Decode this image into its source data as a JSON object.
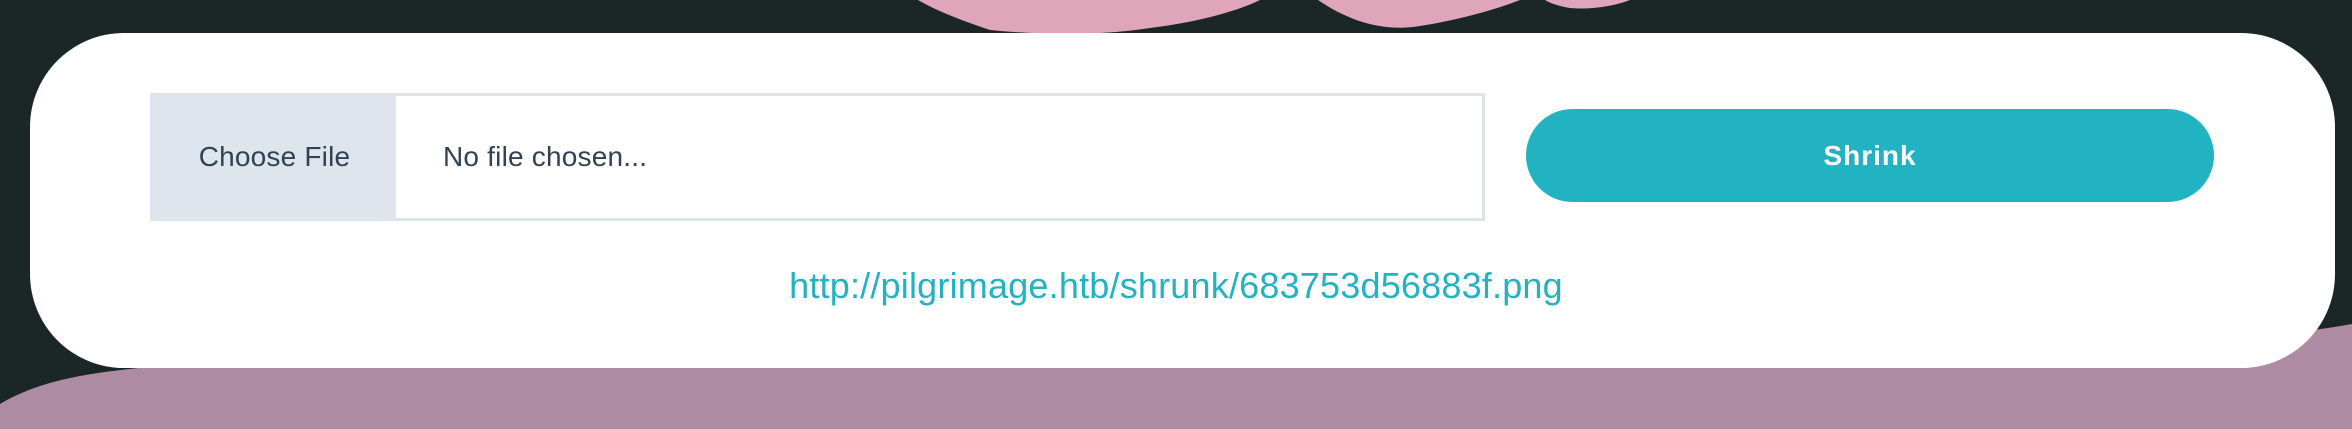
{
  "upload_form": {
    "choose_file_label": "Choose File",
    "file_name_placeholder": "No file chosen...",
    "submit_label": "Shrink"
  },
  "result": {
    "link_text": "http://pilgrimage.htb/shrunk/683753d56883f.png"
  },
  "colors": {
    "accent": "#22b3c2",
    "page_background": "#1b2626",
    "blob_pink": "#dea6b8",
    "wave_mauve": "#ad8ca3"
  }
}
